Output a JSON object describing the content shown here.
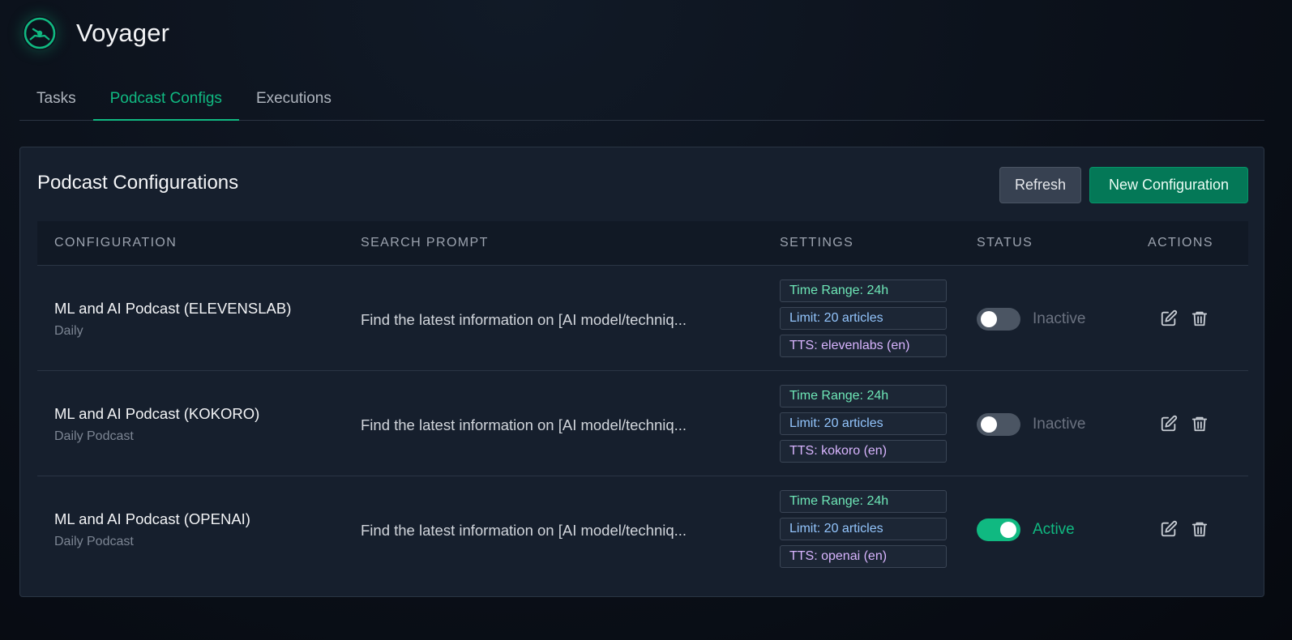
{
  "app": {
    "title": "Voyager",
    "logo_icon": "compass-icon"
  },
  "tabs": [
    {
      "label": "Tasks",
      "active": false
    },
    {
      "label": "Podcast Configs",
      "active": true
    },
    {
      "label": "Executions",
      "active": false
    }
  ],
  "card": {
    "title": "Podcast Configurations",
    "refresh_label": "Refresh",
    "new_label": "New Configuration"
  },
  "table": {
    "headers": {
      "configuration": "CONFIGURATION",
      "search_prompt": "SEARCH PROMPT",
      "settings": "SETTINGS",
      "status": "STATUS",
      "actions": "ACTIONS"
    },
    "rows": [
      {
        "name": "ML and AI Podcast (ELEVENSLAB)",
        "subtitle": "Daily",
        "prompt": "Find the latest information on [AI model/techniq...",
        "time_range": "Time Range: 24h",
        "limit": "Limit: 20 articles",
        "tts": "TTS: elevenlabs (en)",
        "active": false,
        "status": "Inactive"
      },
      {
        "name": "ML and AI Podcast (KOKORO)",
        "subtitle": "Daily Podcast",
        "prompt": "Find the latest information on [AI model/techniq...",
        "time_range": "Time Range: 24h",
        "limit": "Limit: 20 articles",
        "tts": "TTS: kokoro (en)",
        "active": false,
        "status": "Inactive"
      },
      {
        "name": "ML and AI Podcast (OPENAI)",
        "subtitle": "Daily Podcast",
        "prompt": "Find the latest information on [AI model/techniq...",
        "time_range": "Time Range: 24h",
        "limit": "Limit: 20 articles",
        "tts": "TTS: openai (en)",
        "active": true,
        "status": "Active"
      }
    ]
  },
  "colors": {
    "accent": "#10b981",
    "primary_button": "#047857",
    "background": "#0c121c",
    "card": "#161f2d"
  }
}
